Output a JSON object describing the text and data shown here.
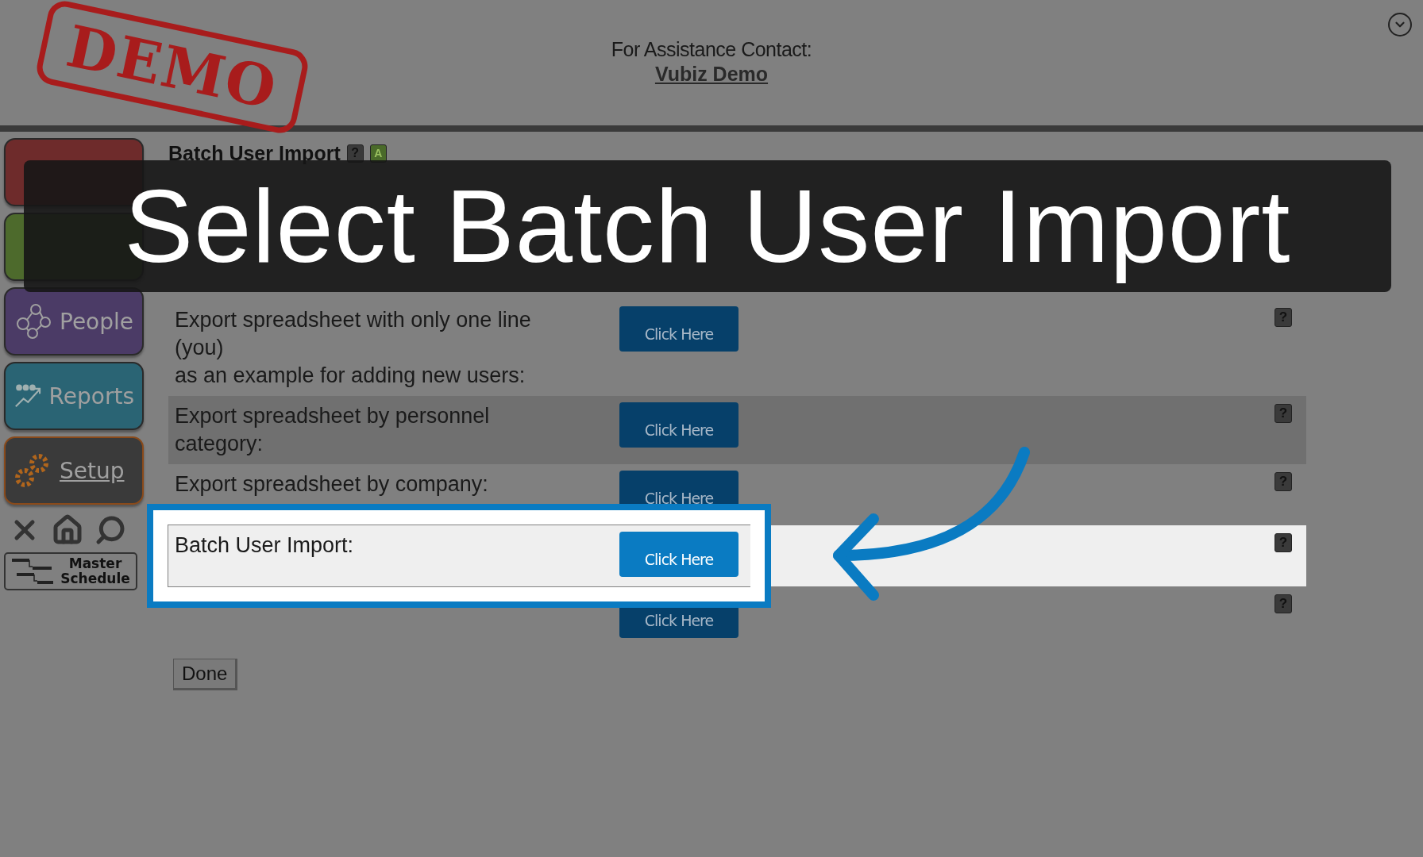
{
  "header": {
    "logo": "DEMO",
    "contact_label": "For Assistance Contact:",
    "contact_link": "Vubiz Demo"
  },
  "nav": [
    {
      "kind": "courses",
      "color": "#6e2b2b"
    },
    {
      "kind": "content",
      "color": "#4d6a2c"
    },
    {
      "label": "People",
      "kind": "people",
      "color": "#4b3b66"
    },
    {
      "label": "Reports",
      "kind": "reports",
      "color": "#2a6474"
    },
    {
      "label": "Setup",
      "kind": "setup",
      "color": "#3a3a3a"
    }
  ],
  "master_schedule": "Master Schedule",
  "page": {
    "title": "Batch User Import",
    "help": "?",
    "badge": "A"
  },
  "rows": [
    {
      "lines": [
        "Export spreadsheet with only one line",
        "(you)",
        "as an example for adding new users:"
      ],
      "button": "Click Here",
      "help": "?",
      "shaded": false,
      "highlighted": false
    },
    {
      "lines": [
        "Export spreadsheet by personnel",
        "category:"
      ],
      "button": "Click Here",
      "help": "?",
      "shaded": true,
      "highlighted": false
    },
    {
      "lines": [
        "Export spreadsheet by company:"
      ],
      "button": "Click Here",
      "help": "?",
      "shaded": false,
      "highlighted": false
    },
    {
      "lines": [
        "Batch User Import:"
      ],
      "button": "Click Here",
      "help": "?",
      "shaded": true,
      "highlighted": true
    },
    {
      "button": "Click Here",
      "help": "?",
      "shaded": false,
      "highlighted": false
    }
  ],
  "done": "Done",
  "caption": "Select Batch User Import"
}
